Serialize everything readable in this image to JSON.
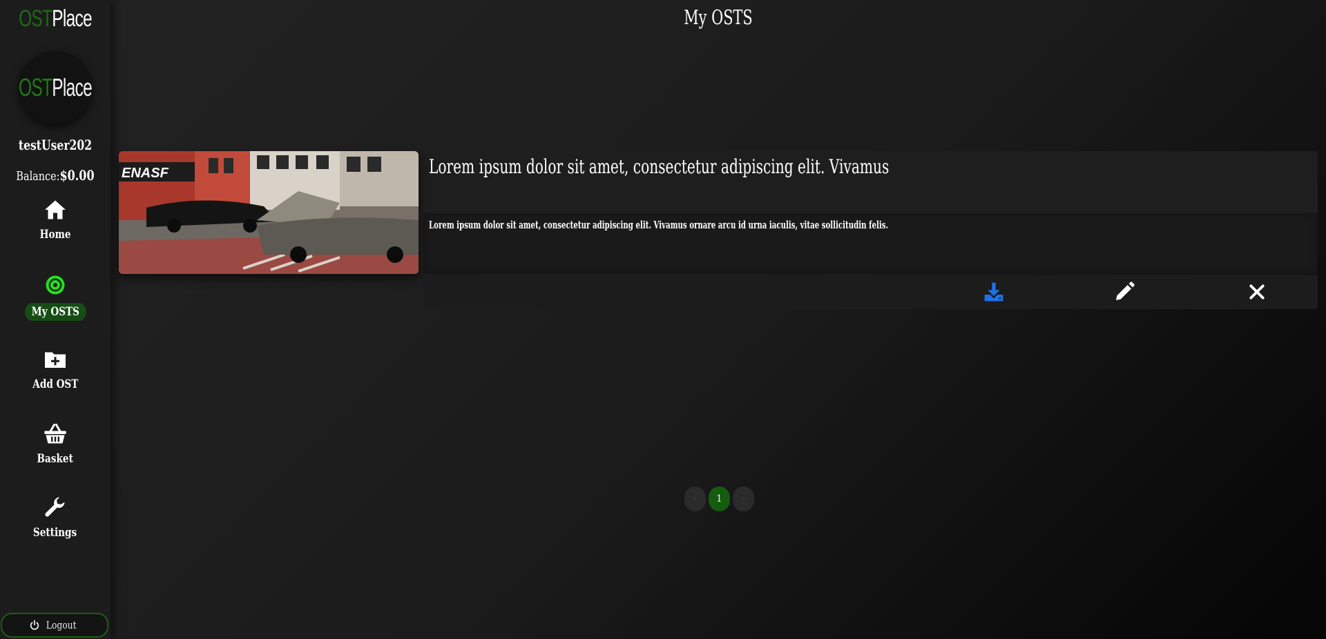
{
  "brand": {
    "ost": "OST",
    "place": "Place"
  },
  "avatar": {
    "ost": "OST",
    "place": "Place"
  },
  "user": {
    "name": "testUser202",
    "balance_label": "Balance:",
    "balance_value": "$0.00"
  },
  "nav": {
    "items": [
      {
        "label": "Home",
        "icon": "home-icon"
      },
      {
        "label": "My OSTS",
        "icon": "disc-icon",
        "active": true
      },
      {
        "label": "Add OST",
        "icon": "folder-plus-icon"
      },
      {
        "label": "Basket",
        "icon": "basket-icon"
      },
      {
        "label": "Settings",
        "icon": "wrench-icon"
      }
    ]
  },
  "logout": {
    "label": "Logout",
    "icon": "power-icon"
  },
  "page": {
    "title": "My OSTS"
  },
  "ost_card": {
    "title": "Lorem ipsum dolor sit amet, consectetur adipiscing elit. Vivamus",
    "description": "Lorem ipsum dolor sit amet, consectetur adipiscing elit. Vivamus ornare arcu id urna iaculis, vitae sollicitudin felis.",
    "image_sign_text": "ENASF",
    "actions": [
      {
        "icon": "download-icon",
        "color": "#1a73e8"
      },
      {
        "icon": "pencil-icon",
        "color": "#ffffff"
      },
      {
        "icon": "close-icon",
        "color": "#ffffff"
      }
    ]
  },
  "pagination": {
    "prev": "‹",
    "current": "1",
    "next": "›"
  },
  "colors": {
    "accent_green": "#145c0e",
    "brand_green": "#1c6b12",
    "download_blue": "#1a73e8"
  }
}
